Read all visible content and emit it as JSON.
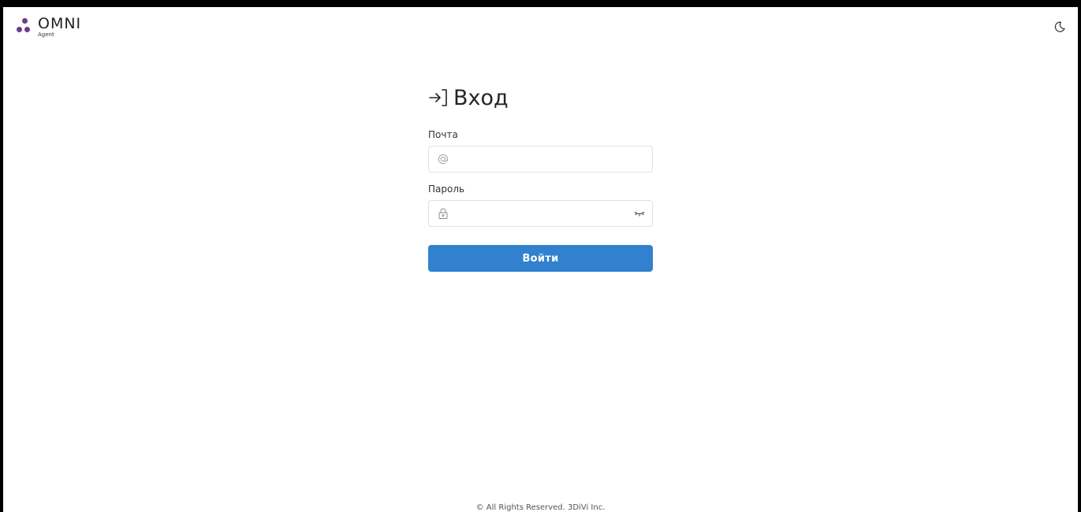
{
  "header": {
    "logo_word": "OMNI",
    "logo_sub": "Agent",
    "logo_color": "#6a3e8a"
  },
  "login": {
    "title": "Вход",
    "email_label": "Почта",
    "email_value": "",
    "password_label": "Пароль",
    "password_value": "",
    "submit_label": "Войти",
    "accent_color": "#3181ce"
  },
  "icons": {
    "title": "login-arrow-icon",
    "email": "at-sign-icon",
    "password": "lock-icon",
    "password_toggle": "eye-closed-icon",
    "theme": "moon-icon"
  },
  "footer": {
    "text": "© All Rights Reserved. 3DiVi Inc."
  }
}
